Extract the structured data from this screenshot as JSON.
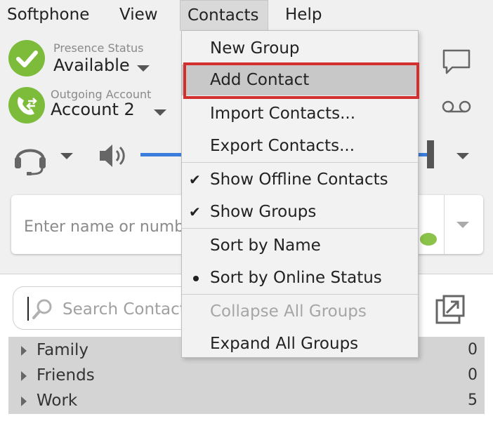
{
  "menubar": {
    "items": [
      {
        "label": "Softphone"
      },
      {
        "label": "View"
      },
      {
        "label": "Contacts"
      },
      {
        "label": "Help"
      }
    ]
  },
  "presence": {
    "label": "Presence Status",
    "value": "Available"
  },
  "account": {
    "label": "Outgoing Account",
    "value": "Account 2"
  },
  "dial": {
    "placeholder": "Enter name or number"
  },
  "volume": {
    "level": 0.9
  },
  "search": {
    "placeholder": "Search Contacts"
  },
  "groups": [
    {
      "name": "Family",
      "count": "0"
    },
    {
      "name": "Friends",
      "count": "0"
    },
    {
      "name": "Work",
      "count": "5"
    }
  ],
  "contacts_menu": {
    "items": [
      {
        "label": "New Group"
      },
      {
        "label": "Add Contact",
        "highlighted": true
      },
      {
        "label": "Import Contacts..."
      },
      {
        "label": "Export Contacts..."
      },
      {
        "label": "Show Offline Contacts",
        "checked": true
      },
      {
        "label": "Show Groups",
        "checked": true
      },
      {
        "label": "Sort by Name"
      },
      {
        "label": "Sort by Online Status",
        "selected": true
      },
      {
        "label": "Collapse All Groups",
        "disabled": true
      },
      {
        "label": "Expand All Groups"
      }
    ]
  },
  "colors": {
    "accent_green": "#7cbc3a",
    "highlight_border": "#d32f2f",
    "volume_blue": "#3b7ddd"
  }
}
